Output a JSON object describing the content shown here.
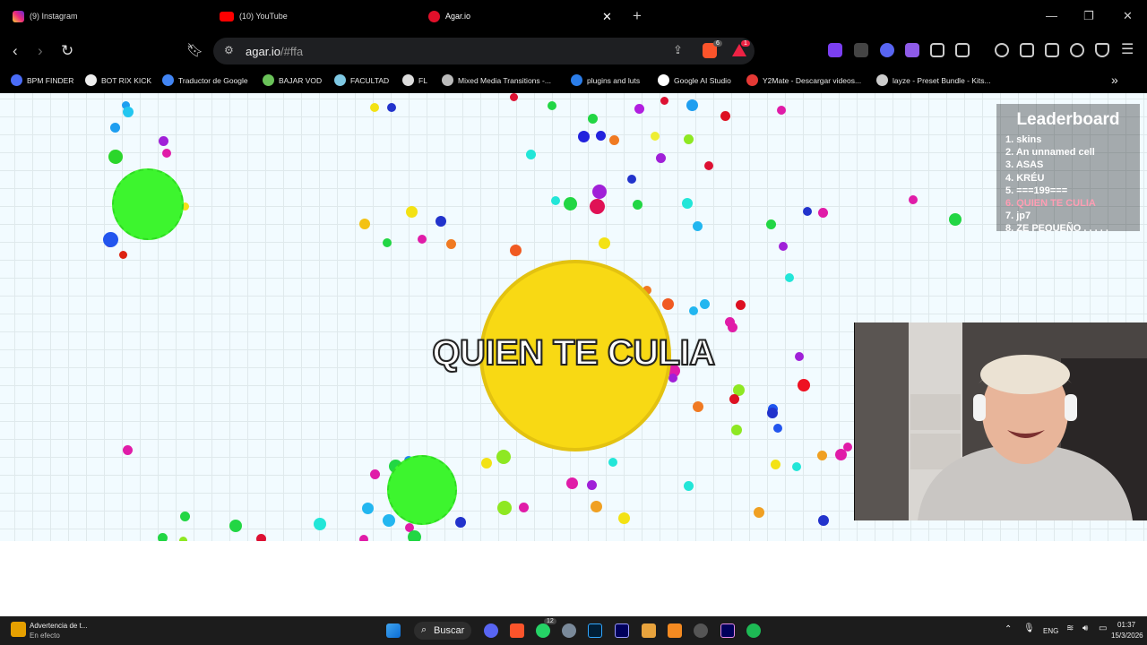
{
  "browser": {
    "tabs": [
      {
        "label": "(9) Instagram",
        "icon": "instagram-icon",
        "color": "#d62976"
      },
      {
        "label": "(10) YouTube",
        "icon": "youtube-icon",
        "color": "#ff0000"
      },
      {
        "label": "Agar.io",
        "icon": "agar-icon",
        "color": "#e0102a",
        "active": true
      }
    ],
    "url_host": "agar.io",
    "url_path": "/#ffa",
    "brave_badge": "6",
    "rewards_badge": "1",
    "bookmarks": [
      {
        "label": "BPM FINDER",
        "icon": "bpm-icon",
        "color": "#4a6cf7"
      },
      {
        "label": "BOT RIX KICK",
        "icon": "bot-icon",
        "color": "#eeeeee"
      },
      {
        "label": "Traductor de Google",
        "icon": "translate-icon",
        "color": "#4285f4"
      },
      {
        "label": "BAJAR VOD",
        "icon": "download-icon",
        "color": "#6ac259"
      },
      {
        "label": "FACULTAD",
        "icon": "cloud-icon",
        "color": "#7ec8e3"
      },
      {
        "label": "FL",
        "icon": "fl-icon",
        "color": "#dddddd"
      },
      {
        "label": "Mixed Media Transitions -...",
        "icon": "mm-icon",
        "color": "#bbbbbb"
      },
      {
        "label": "plugins and luts",
        "icon": "plugins-icon",
        "color": "#2b7de9"
      },
      {
        "label": "Google AI Studio",
        "icon": "google-icon",
        "color": "#ffffff"
      },
      {
        "label": "Y2Mate - Descargar videos...",
        "icon": "y2mate-icon",
        "color": "#e53935"
      },
      {
        "label": "layze - Preset Bundle - Kits...",
        "icon": "headphones-icon",
        "color": "#cccccc"
      }
    ]
  },
  "game": {
    "player_name": "QUIEN TE CULIA",
    "player_color": "#f8d914",
    "virus_color": "#3df52e",
    "leaderboard": {
      "title": "Leaderboard",
      "entries": [
        "1. skins",
        "2. An unnamed cell",
        "3. ASAS",
        "4. KRÉU",
        "5. ===199===",
        "6. QUIEN TE CULIA",
        "7. jp7",
        "8. ZE PEQUEÑO . . . . ."
      ],
      "highlight_index": 5
    }
  },
  "taskbar": {
    "notification_title": "Advertencia de t...",
    "notification_sub": "En efecto",
    "search_label": "Buscar",
    "whatsapp_badge": "12",
    "lang": "ENG",
    "time": "01:37",
    "date": "15/3/2026"
  }
}
